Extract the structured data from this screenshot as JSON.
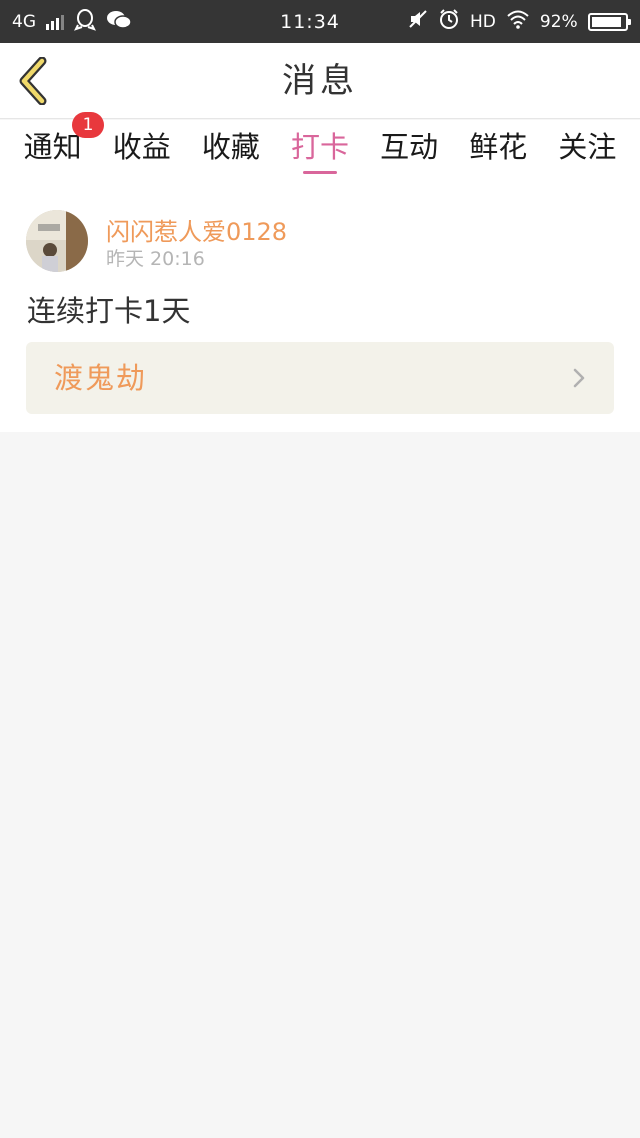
{
  "status_bar": {
    "network": "4G",
    "time": "11:34",
    "hd": "HD",
    "battery": "92%",
    "battery_level": 0.92
  },
  "header": {
    "title": "消息"
  },
  "tabs": [
    {
      "label": "通知",
      "badge": "1"
    },
    {
      "label": "收益"
    },
    {
      "label": "收藏"
    },
    {
      "label": "打卡",
      "active": true
    },
    {
      "label": "互动"
    },
    {
      "label": "鲜花"
    },
    {
      "label": "关注"
    }
  ],
  "message": {
    "username": "闪闪惹人爱0128",
    "time": "昨天 20:16",
    "text": "连续打卡1天",
    "book_title": "渡鬼劫"
  },
  "colors": {
    "accent_pink": "#d9669b",
    "accent_orange": "#ef9a5a",
    "badge_red": "#e8383d",
    "status_bar_bg": "#353535"
  }
}
